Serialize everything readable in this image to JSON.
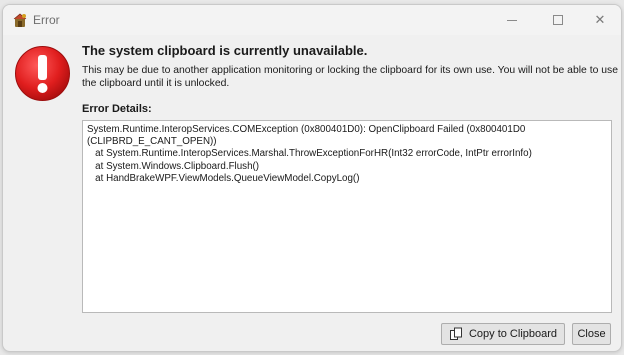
{
  "window": {
    "title": "Error",
    "caption": {
      "minimize": "",
      "maximize": "",
      "close": "✕"
    }
  },
  "message": {
    "heading": "The system clipboard is currently unavailable.",
    "description": "This may be due to another application monitoring or locking the clipboard for its own use. You will not be able to use the clipboard until it is unlocked."
  },
  "details": {
    "label": "Error Details:",
    "text": "System.Runtime.InteropServices.COMException (0x800401D0): OpenClipboard Failed (0x800401D0\n(CLIPBRD_E_CANT_OPEN))\n   at System.Runtime.InteropServices.Marshal.ThrowExceptionForHR(Int32 errorCode, IntPtr errorInfo)\n   at System.Windows.Clipboard.Flush()\n   at HandBrakeWPF.ViewModels.QueueViewModel.CopyLog()"
  },
  "buttons": {
    "copy": "Copy to Clipboard",
    "close": "Close"
  },
  "icons": {
    "app": "handbrake-app-icon",
    "error": "error-icon",
    "copy": "copy-icon"
  },
  "colors": {
    "error_red": "#e81123"
  }
}
